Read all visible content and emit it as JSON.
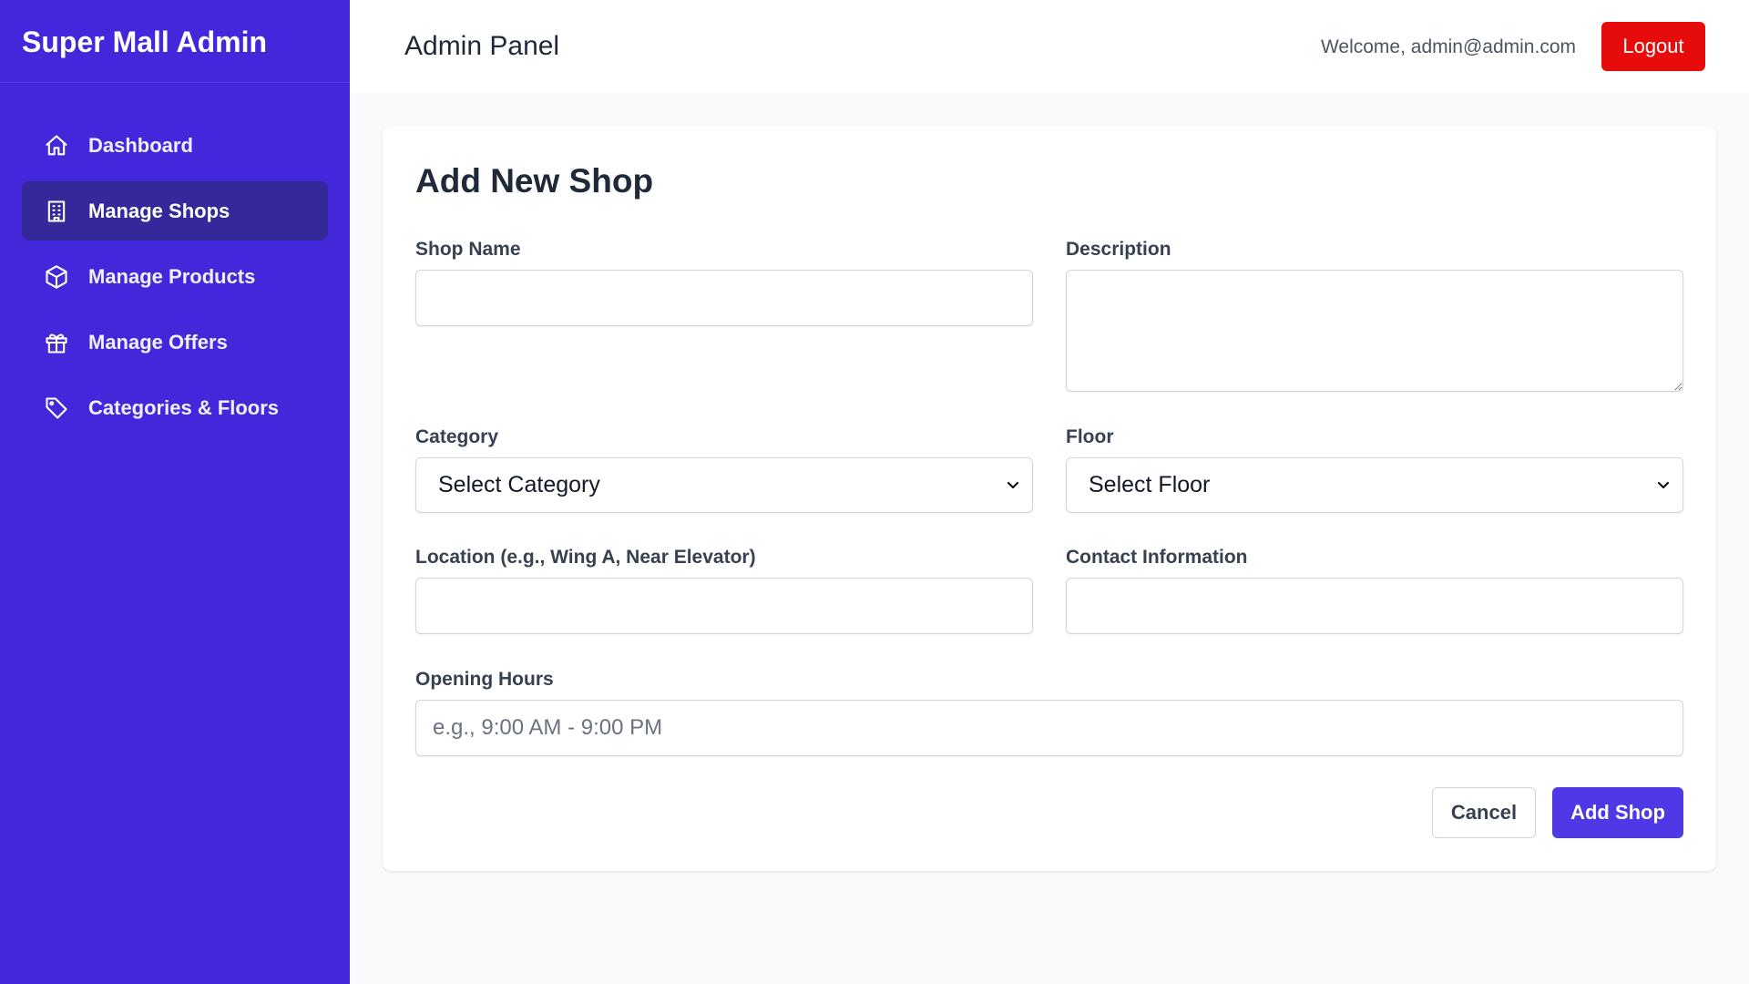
{
  "brand": "Super Mall Admin",
  "sidebar": {
    "items": [
      {
        "label": "Dashboard",
        "icon": "home-icon"
      },
      {
        "label": "Manage Shops",
        "icon": "building-icon",
        "active": true
      },
      {
        "label": "Manage Products",
        "icon": "cube-icon"
      },
      {
        "label": "Manage Offers",
        "icon": "gift-icon"
      },
      {
        "label": "Categories & Floors",
        "icon": "tag-icon"
      }
    ]
  },
  "header": {
    "title": "Admin Panel",
    "welcome": "Welcome, admin@admin.com",
    "logout_label": "Logout"
  },
  "form": {
    "title": "Add New Shop",
    "shop_name": {
      "label": "Shop Name",
      "value": "",
      "placeholder": ""
    },
    "description": {
      "label": "Description",
      "value": "",
      "placeholder": ""
    },
    "category": {
      "label": "Category",
      "selected": "Select Category"
    },
    "floor": {
      "label": "Floor",
      "selected": "Select Floor"
    },
    "location": {
      "label": "Location (e.g., Wing A, Near Elevator)",
      "value": "",
      "placeholder": ""
    },
    "contact": {
      "label": "Contact Information",
      "value": "",
      "placeholder": ""
    },
    "hours": {
      "label": "Opening Hours",
      "value": "",
      "placeholder": "e.g., 9:00 AM - 9:00 PM"
    },
    "cancel_label": "Cancel",
    "submit_label": "Add Shop"
  },
  "colors": {
    "sidebar_bg": "#4328db",
    "sidebar_active": "#34289a",
    "logout": "#e60c0c",
    "primary_button": "#4f38e6"
  }
}
